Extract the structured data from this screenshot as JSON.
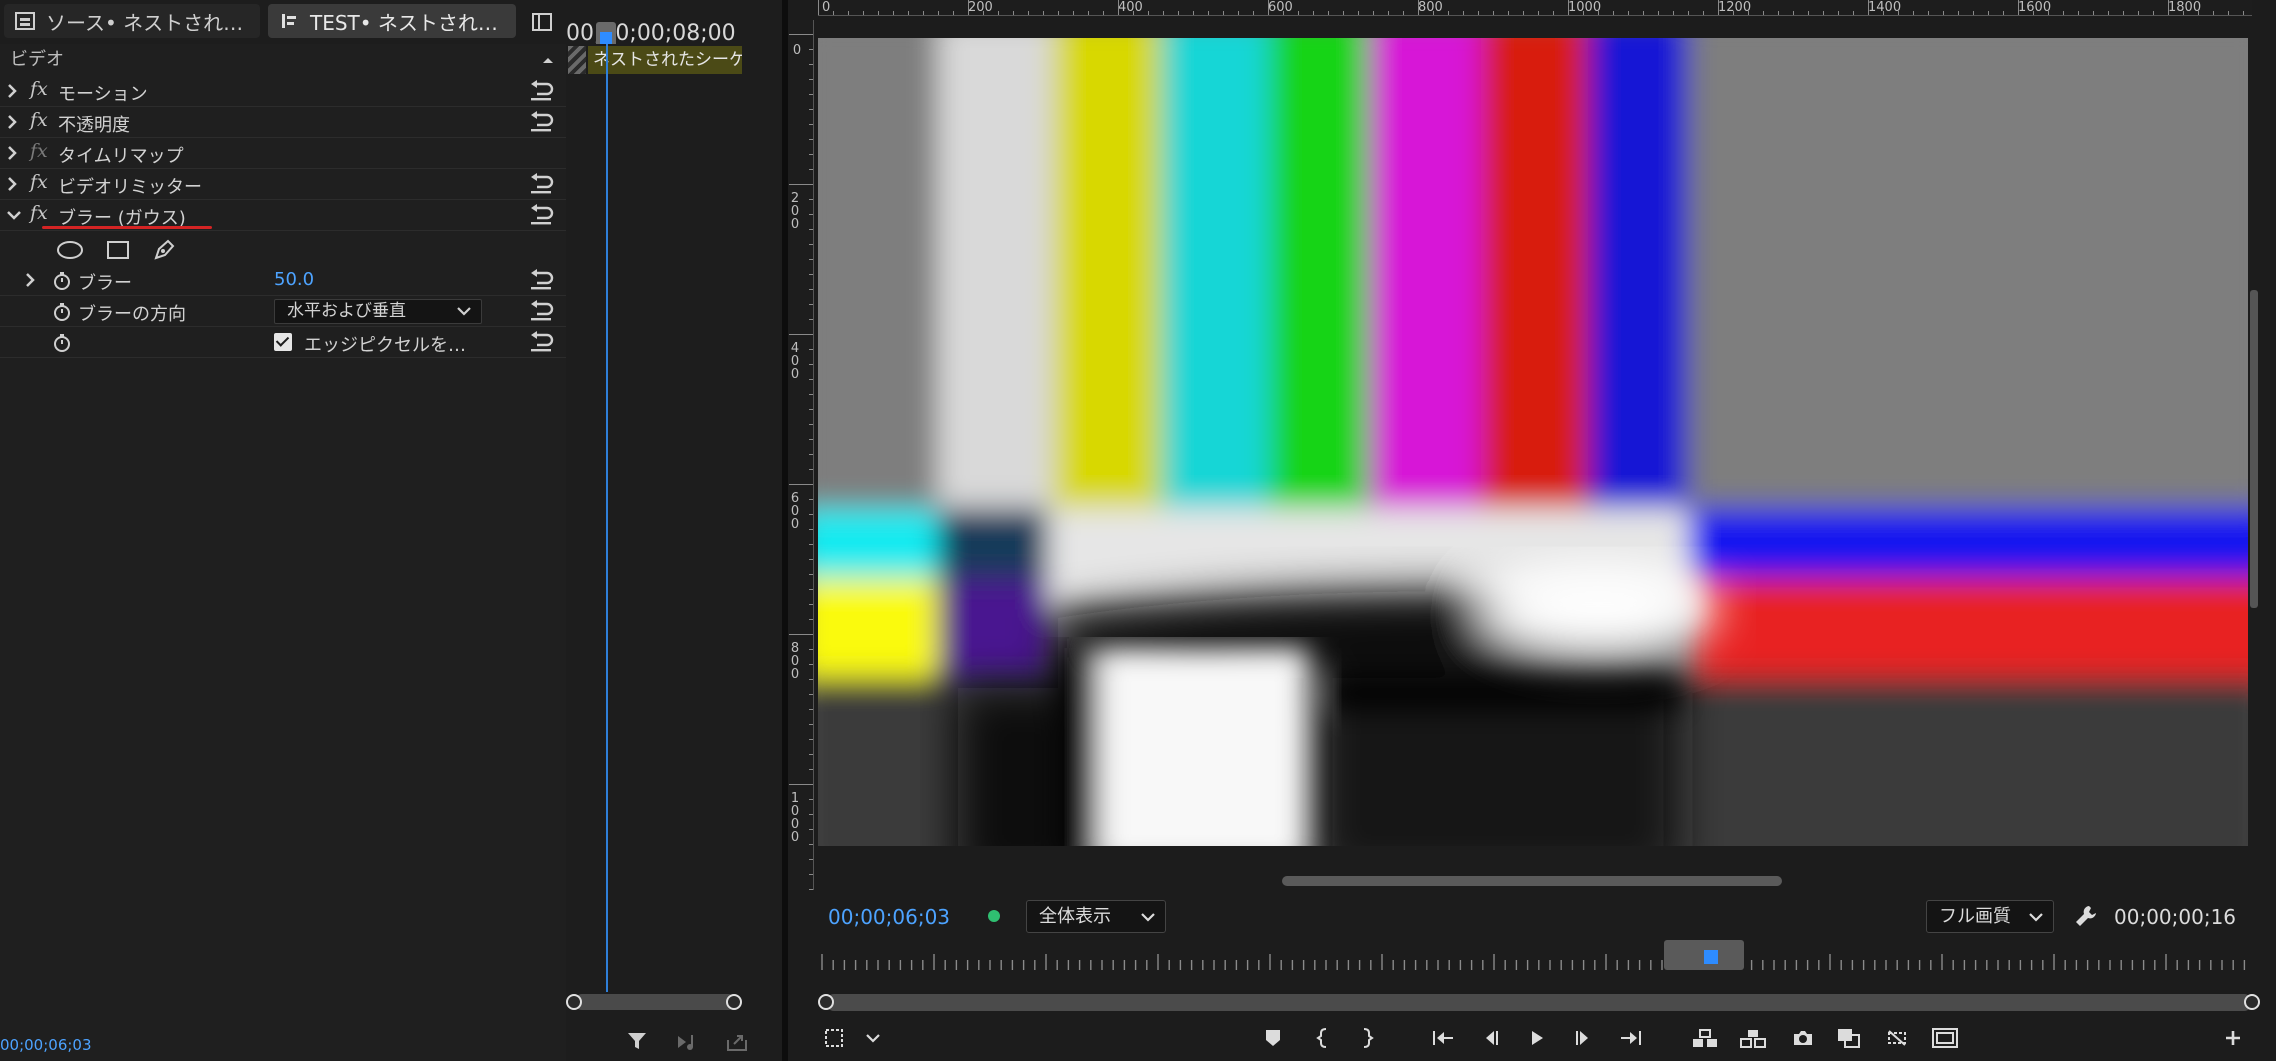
{
  "tabs": [
    {
      "label": "ソース• ネストされ…",
      "icon": "source-monitor-icon"
    },
    {
      "label": "TEST• ネストされ…",
      "icon": "effect-controls-icon"
    }
  ],
  "effect_controls": {
    "section_label": "ビデオ",
    "effects": [
      {
        "label": "モーション"
      },
      {
        "label": "不透明度"
      },
      {
        "label": "タイムリマップ"
      },
      {
        "label": "ビデオリミッター"
      },
      {
        "label": "ブラー (ガウス)"
      }
    ],
    "params": {
      "blur_label": "ブラー",
      "blur_value": "50.0",
      "direction_label": "ブラーの方向",
      "direction_value": "水平および垂直",
      "edge_label": "エッジピクセルを…"
    },
    "timecode": "00;00;06;03"
  },
  "mini_timeline": {
    "timecode": "00;00;00;08;00",
    "clip_label": "ネストされたシーケ"
  },
  "program": {
    "ruler_x": [
      "0",
      "200",
      "400",
      "600",
      "800",
      "1000",
      "1200",
      "1400",
      "1600",
      "1800"
    ],
    "ruler_y": [
      "0",
      "200",
      "400",
      "600",
      "800",
      "1000"
    ],
    "timecode_current": "00;00;06;03",
    "zoom": "全体表示",
    "quality": "フル画質",
    "timecode_duration": "00;00;00;16"
  },
  "colors": {
    "accent": "#4da3ff",
    "status": "#2fbf71",
    "clip": "#4b4a16",
    "red_underline": "#d42424"
  }
}
